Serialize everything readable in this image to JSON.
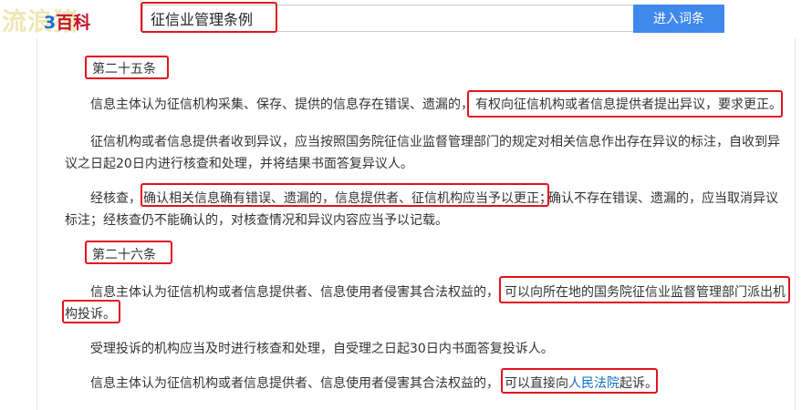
{
  "header": {
    "watermark": "流浪猪",
    "brand_dot": "3",
    "brand": "百科",
    "search_value": "征信业管理条例",
    "search_button": "进入词条"
  },
  "article": {
    "art25": {
      "heading": "第二十五条",
      "p1_plain": "信息主体认为征信机构采集、保存、提供的信息存在错误、遗漏的，",
      "p1_highlight": "有权向征信机构或者信息提供者提出异议，要求更正。",
      "p2_line1": "征信机构或者信息提供者收到异议，应当按照国务院征信业监督管理部门的规定对相关信息作出存在异议的标注，自收到异",
      "p2_line2": "议之日起20日内进行核查和处理，并将结果书面答复异议人。",
      "p3_prefix": "经核查，",
      "p3_highlight": "确认相关信息确有错误、遗漏的，信息提供者、征信机构应当予以更正；",
      "p3_rest": "确认不存在错误、遗漏的，应当取消异议",
      "p3_line2": "标注；经核查仍不能确认的，对核查情况和异议内容应当予以记载。"
    },
    "art26": {
      "heading": "第二十六条",
      "p1_plain": "信息主体认为征信机构或者信息提供者、信息使用者侵害其合法权益的，",
      "p1_highlight_a": "可以向所在地的国务院征信业监督管理部门派出机",
      "p1_highlight_b": "构投诉。",
      "p2": "受理投诉的机构应当及时进行核查和处理，自受理之日起30日内书面答复投诉人。",
      "p3_plain": "信息主体认为征信机构或者信息提供者、信息使用者侵害其合法权益的，",
      "p3_hl_a": "可以直接向",
      "p3_link": "人民法院",
      "p3_hl_b": "起诉。"
    }
  }
}
